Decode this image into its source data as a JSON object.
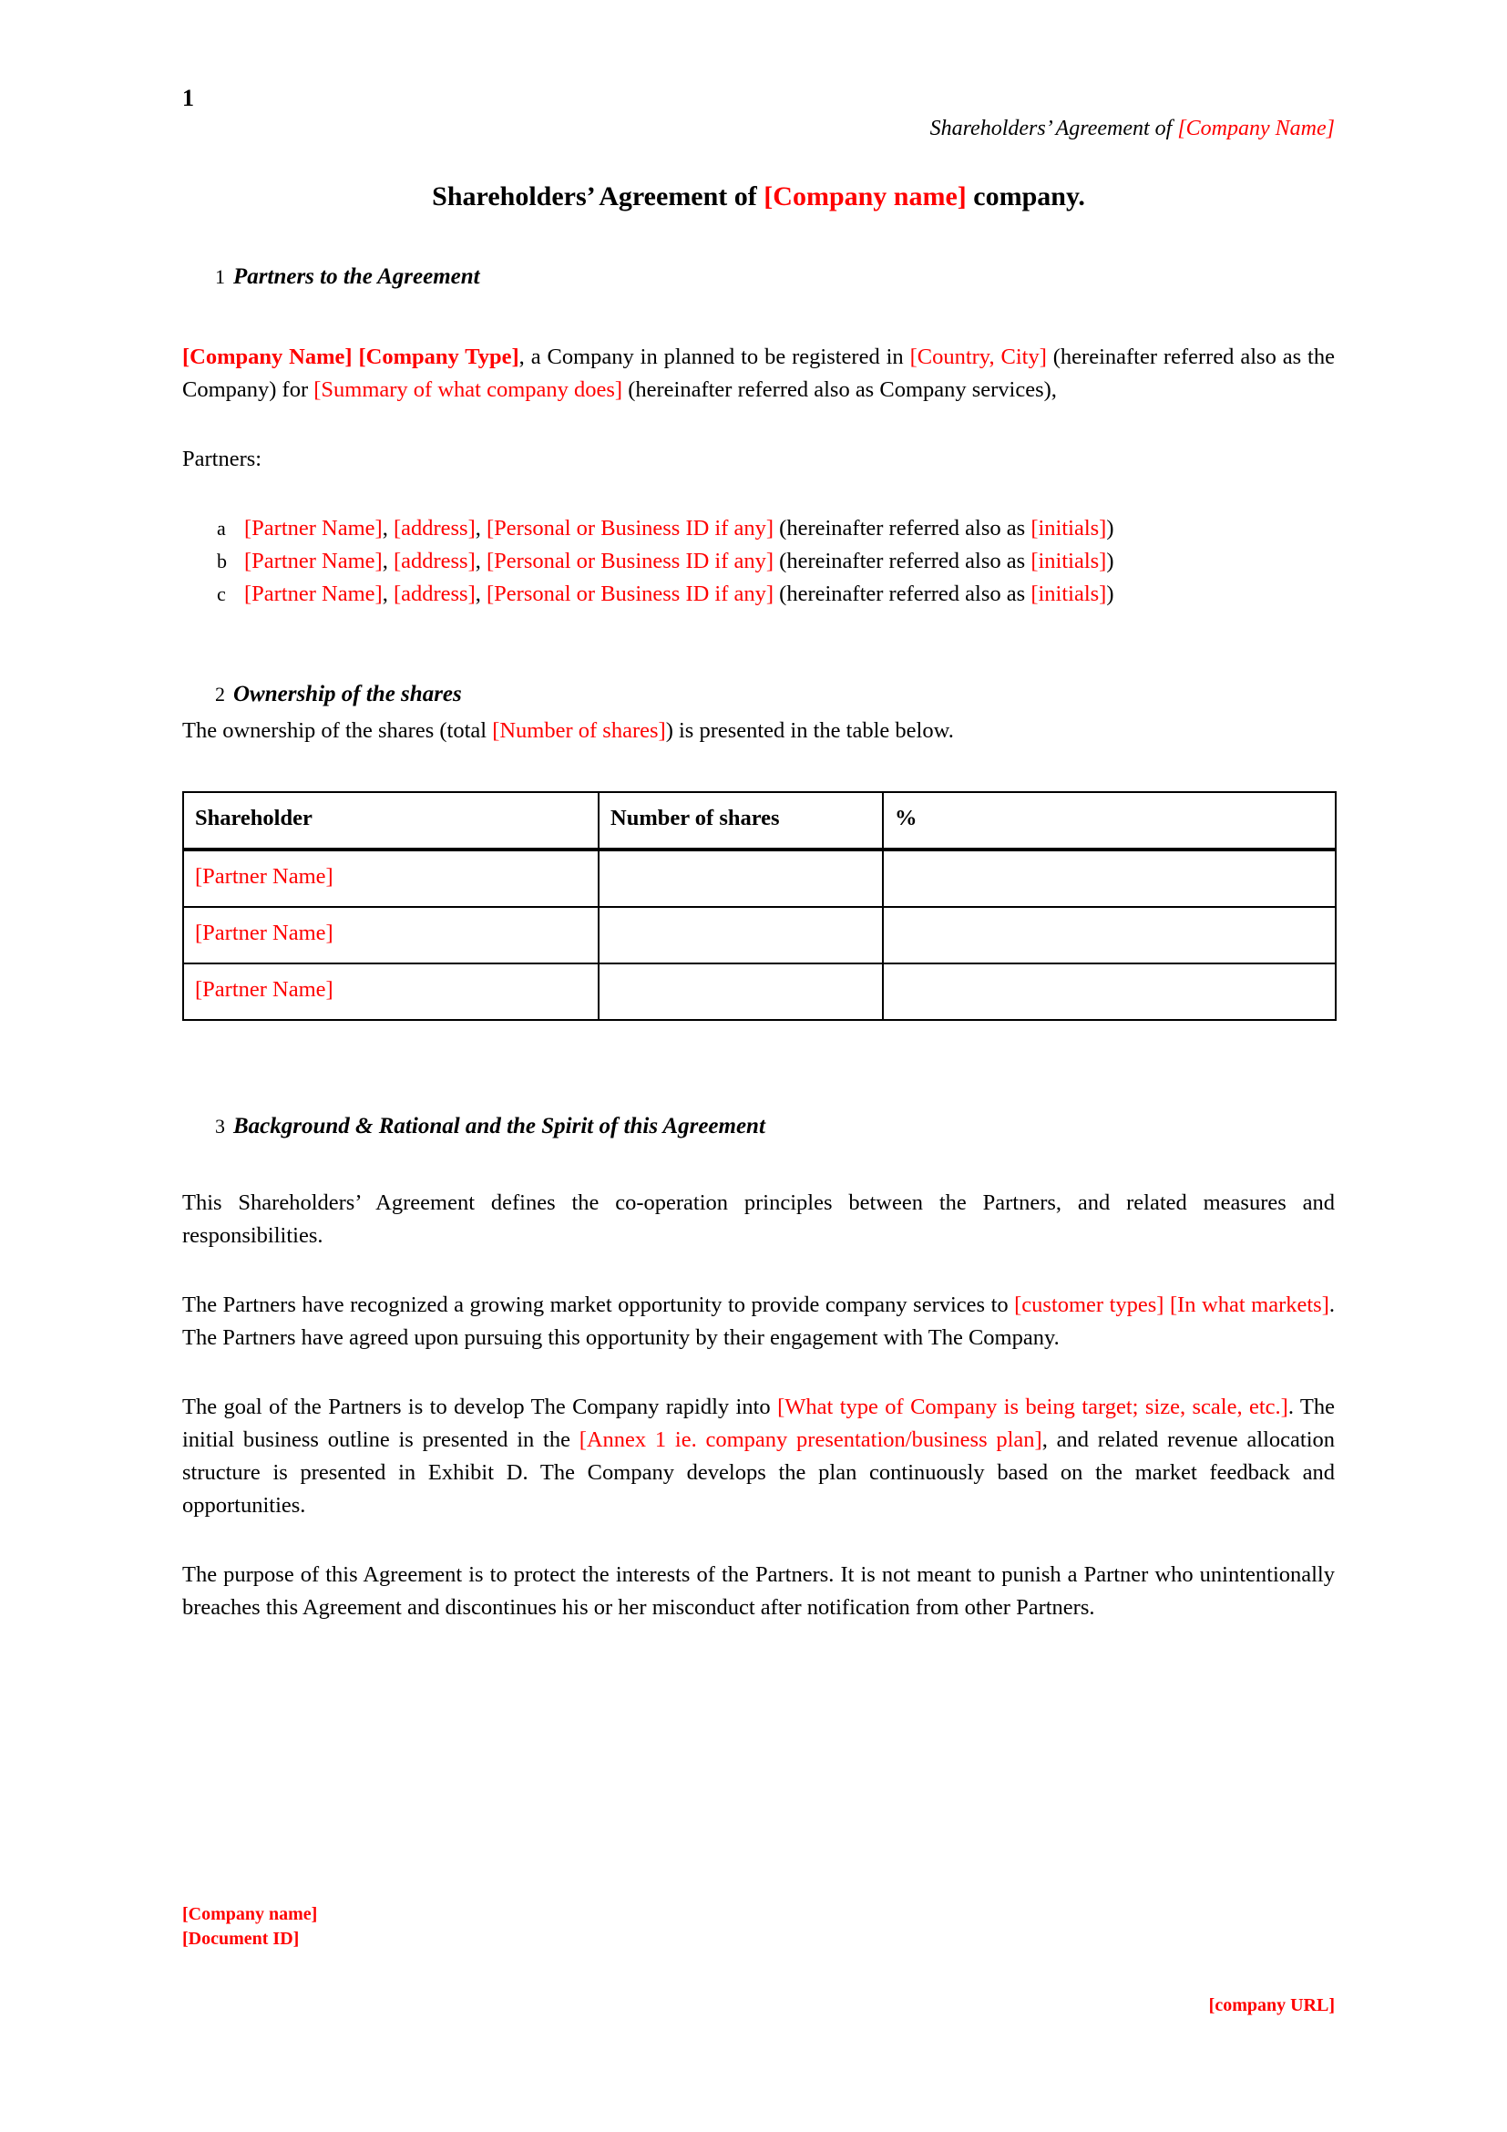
{
  "page": {
    "number": "1",
    "running_head_plain": "Shareholders’ Agreement of ",
    "running_head_red": "[Company Name]"
  },
  "title": {
    "part1": "Shareholders’ Agreement of ",
    "company": "[Company name]",
    "part2": " company."
  },
  "sections": [
    {
      "number": "1",
      "heading": "Partners to the Agreement"
    },
    {
      "number": "2",
      "heading": "Ownership of the shares"
    },
    {
      "number": "3",
      "heading": "Background & Rational and the Spirit of this Agreement"
    }
  ],
  "section1": {
    "intro": {
      "company_name": "[Company Name]",
      "company_type": "[Company Type]",
      "t1": ", a Company in planned to be registered in ",
      "country_city": "[Country, City]",
      "t2": " (hereinafter referred also as the Company) for ",
      "summary": "[Summary of what company does]",
      "t3": " (hereinafter referred also as Company services),"
    },
    "partners_label": "Partners:",
    "partners": [
      {
        "marker": "a",
        "name": "[Partner Name]",
        "sep1": ", ",
        "address": "[address]",
        "sep2": ", ",
        "id": "[Personal or Business ID if any]",
        "tail": " (hereinafter referred also as ",
        "initials": "[initials]",
        "close": ")"
      },
      {
        "marker": "b",
        "name": "[Partner Name]",
        "sep1": ", ",
        "address": "[address]",
        "sep2": ", ",
        "id": "[Personal or Business ID if any]",
        "tail": " (hereinafter referred also as ",
        "initials": "[initials]",
        "close": ")"
      },
      {
        "marker": "c",
        "name": "[Partner Name]",
        "sep1": ", ",
        "address": "[address]",
        "sep2": ", ",
        "id": "[Personal or Business ID if any]",
        "tail": " (hereinafter referred also as ",
        "initials": "[initials]",
        "close": ")"
      }
    ]
  },
  "section2": {
    "lead_t1": "The ownership of the shares (total ",
    "lead_red": "[Number of shares]",
    "lead_t2": ") is presented in the table below.",
    "table": {
      "headers": [
        "Shareholder",
        "Number of shares",
        "%"
      ],
      "rows": [
        {
          "shareholder": "[Partner Name]",
          "shares": "",
          "percent": ""
        },
        {
          "shareholder": "[Partner Name]",
          "shares": "",
          "percent": ""
        },
        {
          "shareholder": "[Partner Name]",
          "shares": "",
          "percent": ""
        }
      ]
    }
  },
  "section3": {
    "p1": "This Shareholders’ Agreement defines the co-operation principles between the Partners, and related measures and responsibilities.",
    "p2": {
      "t1": "The Partners have recognized a growing market opportunity to provide company services to ",
      "red1": "[customer types] [In what markets]",
      "t2": ". The Partners have agreed upon pursuing this opportunity by their engagement with The Company."
    },
    "p3": {
      "t1": "The goal of the Partners is to develop The Company rapidly into ",
      "red1": "[What type of Company is being target; size, scale, etc.]",
      "t2": ". The initial business outline is presented in the ",
      "red2": "[Annex 1 ie. company presentation/business plan]",
      "t3": ", and related revenue allocation structure is presented in Exhibit D. The Company develops the plan continuously based on the market feedback and opportunities."
    },
    "p4": "The purpose of this Agreement is to protect the interests of the Partners. It is not meant to punish a Partner who unintentionally breaches this Agreement and discontinues his or her misconduct after notification from other Partners."
  },
  "footer": {
    "company_name": "[Company name]",
    "document_id": "[Document ID]",
    "company_url": "[company URL]"
  },
  "colors": {
    "placeholder_red": "#ff0000",
    "text_black": "#000000"
  }
}
